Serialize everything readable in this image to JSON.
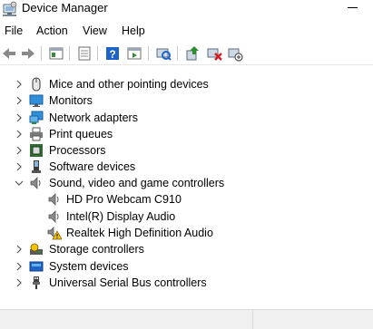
{
  "window": {
    "title": "Device Manager"
  },
  "menu": [
    "File",
    "Action",
    "View",
    "Help"
  ],
  "toolbar": [
    "back-arrow-icon",
    "forward-arrow-icon",
    "properties-window-icon",
    "document-icon",
    "help-icon",
    "action-panel-icon",
    "scan-hardware-icon",
    "update-driver-icon",
    "uninstall-device-icon",
    "disable-device-icon"
  ],
  "tree": [
    {
      "label": "Mice and other pointing devices",
      "icon": "mouse-icon",
      "expanded": false,
      "level": 0
    },
    {
      "label": "Monitors",
      "icon": "monitor-icon",
      "expanded": false,
      "level": 0
    },
    {
      "label": "Network adapters",
      "icon": "network-adapter-icon",
      "expanded": false,
      "level": 0
    },
    {
      "label": "Print queues",
      "icon": "printer-icon",
      "expanded": false,
      "level": 0
    },
    {
      "label": "Processors",
      "icon": "processor-icon",
      "expanded": false,
      "level": 0
    },
    {
      "label": "Software devices",
      "icon": "software-device-icon",
      "expanded": false,
      "level": 0
    },
    {
      "label": "Sound, video and game controllers",
      "icon": "speaker-icon",
      "expanded": true,
      "level": 0
    },
    {
      "label": "HD Pro Webcam C910",
      "icon": "speaker-icon",
      "level": 1
    },
    {
      "label": "Intel(R) Display Audio",
      "icon": "speaker-icon",
      "level": 1
    },
    {
      "label": "Realtek High Definition Audio",
      "icon": "speaker-warning-icon",
      "level": 1,
      "warning": true
    },
    {
      "label": "Storage controllers",
      "icon": "storage-controller-icon",
      "expanded": false,
      "level": 0
    },
    {
      "label": "System devices",
      "icon": "system-device-icon",
      "expanded": false,
      "level": 0
    },
    {
      "label": "Universal Serial Bus controllers",
      "icon": "usb-icon",
      "expanded": false,
      "level": 0
    }
  ],
  "colors": {
    "accent_blue": "#1e64c8",
    "warning_yellow": "#f2c200",
    "error_red": "#d01c1c",
    "green": "#2e8b2e"
  }
}
